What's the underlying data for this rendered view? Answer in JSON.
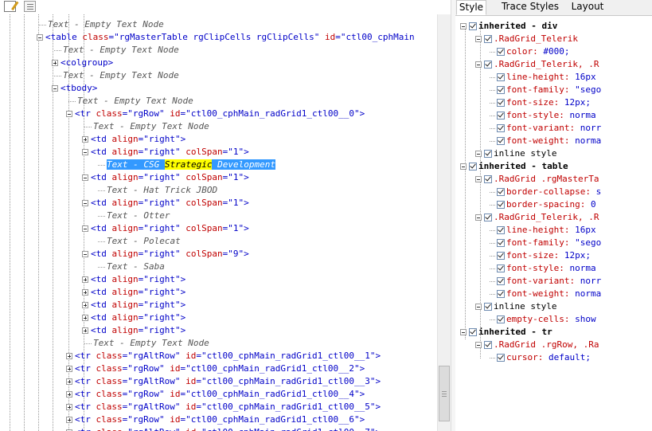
{
  "toolbar": {
    "icons": [
      "edit-icon",
      "word-wrap-icon"
    ]
  },
  "tree": {
    "lines": [
      {
        "indent": 0,
        "kind": "text",
        "text": "Text - Empty Text Node"
      },
      {
        "indent": 0,
        "kind": "element",
        "box": "minus",
        "tag": "table",
        "attrs": [
          {
            "n": "class",
            "v": "\"rgMasterTable rgClipCells rgClipCells\""
          },
          {
            "n": "id",
            "v": "\"ctl00_cphMain"
          }
        ],
        "close": ""
      },
      {
        "indent": 1,
        "kind": "text",
        "text": "Text - Empty Text Node"
      },
      {
        "indent": 1,
        "kind": "element",
        "box": "plus",
        "tag": "colgroup",
        "attrs": [],
        "close": ">"
      },
      {
        "indent": 1,
        "kind": "text",
        "text": "Text - Empty Text Node"
      },
      {
        "indent": 1,
        "kind": "element",
        "box": "minus",
        "tag": "tbody",
        "attrs": [],
        "close": ">"
      },
      {
        "indent": 2,
        "kind": "text",
        "text": "Text - Empty Text Node"
      },
      {
        "indent": 2,
        "kind": "element",
        "box": "minus",
        "tag": "tr",
        "attrs": [
          {
            "n": "class",
            "v": "\"rgRow\""
          },
          {
            "n": "id",
            "v": "\"ctl00_cphMain_radGrid1_ctl00__0\""
          }
        ],
        "close": ">"
      },
      {
        "indent": 3,
        "kind": "text",
        "text": "Text - Empty Text Node"
      },
      {
        "indent": 3,
        "kind": "element",
        "box": "plus",
        "tag": "td",
        "attrs": [
          {
            "n": "align",
            "v": "\"right\""
          }
        ],
        "close": ">"
      },
      {
        "indent": 3,
        "kind": "element",
        "box": "minus",
        "tag": "td",
        "attrs": [
          {
            "n": "align",
            "v": "\"right\""
          },
          {
            "n": "colSpan",
            "v": "\"1\""
          }
        ],
        "close": ">"
      },
      {
        "indent": 4,
        "kind": "selected",
        "parts": [
          "Text - CSG ",
          "Strategic",
          " Development"
        ]
      },
      {
        "indent": 3,
        "kind": "element",
        "box": "minus",
        "tag": "td",
        "attrs": [
          {
            "n": "align",
            "v": "\"right\""
          },
          {
            "n": "colSpan",
            "v": "\"1\""
          }
        ],
        "close": ">"
      },
      {
        "indent": 4,
        "kind": "text",
        "text": "Text - Hat Trick JBOD"
      },
      {
        "indent": 3,
        "kind": "element",
        "box": "minus",
        "tag": "td",
        "attrs": [
          {
            "n": "align",
            "v": "\"right\""
          },
          {
            "n": "colSpan",
            "v": "\"1\""
          }
        ],
        "close": ">"
      },
      {
        "indent": 4,
        "kind": "text",
        "text": "Text - Otter"
      },
      {
        "indent": 3,
        "kind": "element",
        "box": "minus",
        "tag": "td",
        "attrs": [
          {
            "n": "align",
            "v": "\"right\""
          },
          {
            "n": "colSpan",
            "v": "\"1\""
          }
        ],
        "close": ">"
      },
      {
        "indent": 4,
        "kind": "text",
        "text": "Text - Polecat"
      },
      {
        "indent": 3,
        "kind": "element",
        "box": "minus",
        "tag": "td",
        "attrs": [
          {
            "n": "align",
            "v": "\"right\""
          },
          {
            "n": "colSpan",
            "v": "\"9\""
          }
        ],
        "close": ">"
      },
      {
        "indent": 4,
        "kind": "text",
        "text": "Text - Saba"
      },
      {
        "indent": 3,
        "kind": "element",
        "box": "plus",
        "tag": "td",
        "attrs": [
          {
            "n": "align",
            "v": "\"right\""
          }
        ],
        "close": ">"
      },
      {
        "indent": 3,
        "kind": "element",
        "box": "plus",
        "tag": "td",
        "attrs": [
          {
            "n": "align",
            "v": "\"right\""
          }
        ],
        "close": ">"
      },
      {
        "indent": 3,
        "kind": "element",
        "box": "plus",
        "tag": "td",
        "attrs": [
          {
            "n": "align",
            "v": "\"right\""
          }
        ],
        "close": ">"
      },
      {
        "indent": 3,
        "kind": "element",
        "box": "plus",
        "tag": "td",
        "attrs": [
          {
            "n": "align",
            "v": "\"right\""
          }
        ],
        "close": ">"
      },
      {
        "indent": 3,
        "kind": "element",
        "box": "plus",
        "tag": "td",
        "attrs": [
          {
            "n": "align",
            "v": "\"right\""
          }
        ],
        "close": ">"
      },
      {
        "indent": 3,
        "kind": "text",
        "text": "Text - Empty Text Node"
      },
      {
        "indent": 2,
        "kind": "element",
        "box": "plus",
        "tag": "tr",
        "attrs": [
          {
            "n": "class",
            "v": "\"rgAltRow\""
          },
          {
            "n": "id",
            "v": "\"ctl00_cphMain_radGrid1_ctl00__1\""
          }
        ],
        "close": ">"
      },
      {
        "indent": 2,
        "kind": "element",
        "box": "plus",
        "tag": "tr",
        "attrs": [
          {
            "n": "class",
            "v": "\"rgRow\""
          },
          {
            "n": "id",
            "v": "\"ctl00_cphMain_radGrid1_ctl00__2\""
          }
        ],
        "close": ">"
      },
      {
        "indent": 2,
        "kind": "element",
        "box": "plus",
        "tag": "tr",
        "attrs": [
          {
            "n": "class",
            "v": "\"rgAltRow\""
          },
          {
            "n": "id",
            "v": "\"ctl00_cphMain_radGrid1_ctl00__3\""
          }
        ],
        "close": ">"
      },
      {
        "indent": 2,
        "kind": "element",
        "box": "plus",
        "tag": "tr",
        "attrs": [
          {
            "n": "class",
            "v": "\"rgRow\""
          },
          {
            "n": "id",
            "v": "\"ctl00_cphMain_radGrid1_ctl00__4\""
          }
        ],
        "close": ">"
      },
      {
        "indent": 2,
        "kind": "element",
        "box": "plus",
        "tag": "tr",
        "attrs": [
          {
            "n": "class",
            "v": "\"rgAltRow\""
          },
          {
            "n": "id",
            "v": "\"ctl00_cphMain_radGrid1_ctl00__5\""
          }
        ],
        "close": ">"
      },
      {
        "indent": 2,
        "kind": "element",
        "box": "plus",
        "tag": "tr",
        "attrs": [
          {
            "n": "class",
            "v": "\"rgRow\""
          },
          {
            "n": "id",
            "v": "\"ctl00_cphMain_radGrid1_ctl00__6\""
          }
        ],
        "close": ">"
      },
      {
        "indent": 2,
        "kind": "element",
        "box": "plus",
        "tag": "tr",
        "attrs": [
          {
            "n": "class",
            "v": "\"rgAltRow\""
          },
          {
            "n": "id",
            "v": "\"ctl00_cphMain_radGrid1_ctl00__7\""
          }
        ],
        "close": ">"
      }
    ]
  },
  "tabs": [
    {
      "label": "Style",
      "active": true
    },
    {
      "label": "Trace Styles",
      "active": false
    },
    {
      "label": "Layout",
      "active": false
    }
  ],
  "styles": {
    "lines": [
      {
        "level": 0,
        "box": "minus",
        "kind": "inherited",
        "text": "inherited - div"
      },
      {
        "level": 1,
        "box": "minus",
        "kind": "selector",
        "text": ".RadGrid_Telerik"
      },
      {
        "level": 2,
        "kind": "prop",
        "prop": "color:",
        "val": " #000;"
      },
      {
        "level": 1,
        "box": "minus",
        "kind": "selector",
        "text": ".RadGrid_Telerik, .R"
      },
      {
        "level": 2,
        "kind": "prop",
        "prop": "line-height:",
        "val": " 16px"
      },
      {
        "level": 2,
        "kind": "prop",
        "prop": "font-family:",
        "val": " \"sego"
      },
      {
        "level": 2,
        "kind": "prop",
        "prop": "font-size:",
        "val": " 12px;"
      },
      {
        "level": 2,
        "kind": "prop",
        "prop": "font-style:",
        "val": " norma"
      },
      {
        "level": 2,
        "kind": "prop",
        "prop": "font-variant:",
        "val": " norr"
      },
      {
        "level": 2,
        "kind": "prop",
        "prop": "font-weight:",
        "val": " norma"
      },
      {
        "level": 1,
        "box": "minus",
        "kind": "plain",
        "text": "inline style"
      },
      {
        "level": 0,
        "box": "minus",
        "kind": "inherited",
        "text": "inherited - table"
      },
      {
        "level": 1,
        "box": "minus",
        "kind": "selector",
        "text": ".RadGrid .rgMasterTa"
      },
      {
        "level": 2,
        "kind": "prop",
        "prop": "border-collapse:",
        "val": " s"
      },
      {
        "level": 2,
        "kind": "prop",
        "prop": "border-spacing:",
        "val": " 0"
      },
      {
        "level": 1,
        "box": "minus",
        "kind": "selector",
        "text": ".RadGrid_Telerik, .R"
      },
      {
        "level": 2,
        "kind": "prop",
        "prop": "line-height:",
        "val": " 16px"
      },
      {
        "level": 2,
        "kind": "prop",
        "prop": "font-family:",
        "val": " \"sego"
      },
      {
        "level": 2,
        "kind": "prop",
        "prop": "font-size:",
        "val": " 12px;"
      },
      {
        "level": 2,
        "kind": "prop",
        "prop": "font-style:",
        "val": " norma"
      },
      {
        "level": 2,
        "kind": "prop",
        "prop": "font-variant:",
        "val": " norr"
      },
      {
        "level": 2,
        "kind": "prop",
        "prop": "font-weight:",
        "val": " norma"
      },
      {
        "level": 1,
        "box": "minus",
        "kind": "plain",
        "text": "inline style"
      },
      {
        "level": 2,
        "kind": "prop",
        "prop": "empty-cells:",
        "val": " show"
      },
      {
        "level": 0,
        "box": "minus",
        "kind": "inherited",
        "text": "inherited - tr"
      },
      {
        "level": 1,
        "box": "minus",
        "kind": "selector",
        "text": ".RadGrid .rgRow, .Ra"
      },
      {
        "level": 2,
        "kind": "prop",
        "prop": "cursor:",
        "val": " default;"
      }
    ]
  }
}
